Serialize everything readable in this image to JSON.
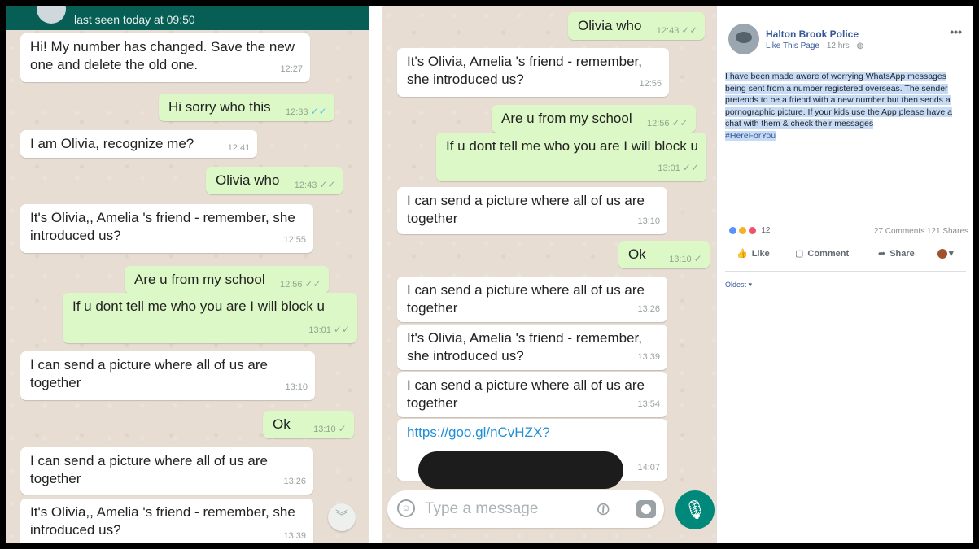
{
  "chat_left": {
    "header_status": "last seen today at 09:50",
    "messages": [
      {
        "text": "Hi! My number has changed. Save the new one and delete the old one.",
        "time": "12:27"
      },
      {
        "text": "Hi sorry who this",
        "time": "12:33"
      },
      {
        "text": "I am Olivia, recognize me?",
        "time": "12:41"
      },
      {
        "text": "Olivia who",
        "time": "12:43"
      },
      {
        "text": "It's Olivia,, Amelia 's friend - remember, she introduced us?",
        "time": "12:55"
      },
      {
        "text": "Are u from my school",
        "time": "12:56"
      },
      {
        "text": "If u dont tell me who you are I will block u",
        "time": "13:01"
      },
      {
        "text": "I can send a picture where all of us are together",
        "time": "13:10"
      },
      {
        "text": "Ok",
        "time": "13:10"
      },
      {
        "text": "I can send a picture where all of us are together",
        "time": "13:26"
      },
      {
        "text": "It's Olivia,, Amelia 's friend - remember, she introduced us?",
        "time": "13:39"
      }
    ]
  },
  "chat_mid": {
    "messages": [
      {
        "text": "Olivia who",
        "time": "12:43"
      },
      {
        "text": "It's Olivia, Amelia 's friend - remember, she introduced us?",
        "time": "12:55"
      },
      {
        "text": "Are u from my school",
        "time": "12:56"
      },
      {
        "text": "If u dont tell me who you are I will block u",
        "time": "13:01"
      },
      {
        "text": "I can send a picture where all of us are together",
        "time": "13:10"
      },
      {
        "text": "Ok",
        "time": "13:10"
      },
      {
        "text": "I can send a picture where all of us are together",
        "time": "13:26"
      },
      {
        "text": "It's Olivia, Amelia 's friend - remember, she introduced us?",
        "time": "13:39"
      },
      {
        "text": "I can send a picture where all of us are together",
        "time": "13:54"
      },
      {
        "text": "https://goo.gl/nCvHZX?",
        "time": "14:07"
      }
    ],
    "composer_placeholder": "Type a message"
  },
  "facebook": {
    "page_name": "Halton Brook Police",
    "like_page": "Like This Page",
    "posted": "· 12 hrs ·",
    "post_text": "I have been made aware of worrying WhatsApp messages being sent from a number registered overseas. The sender pretends to be a friend with a new number but then sends a pornographic picture. If your kids use the App please have a chat with them & check their messages",
    "hashtag": "#HereForYou",
    "reaction_count": "12",
    "comments_shares": "27 Comments  121 Shares",
    "like_label": "Like",
    "comment_label": "Comment",
    "share_label": "Share",
    "oldest_label": "Oldest ▾",
    "more_label": "•••"
  },
  "colors": {
    "wa_header": "#075e54",
    "bubble_out": "#dcf8c6",
    "bubble_in": "#ffffff",
    "fb_link": "#365899",
    "highlight": "#c7dcf4"
  }
}
